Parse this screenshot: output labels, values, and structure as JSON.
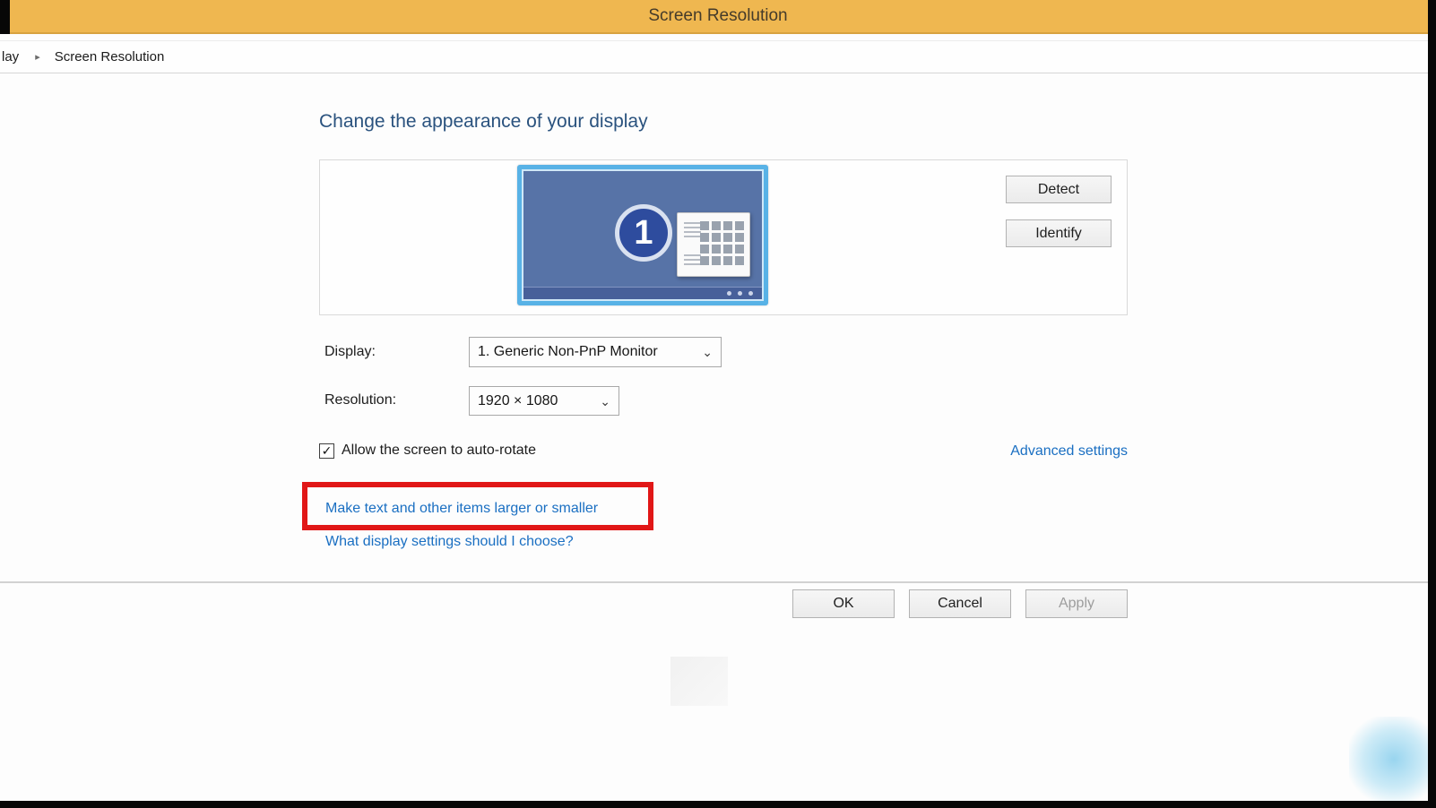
{
  "colors": {
    "titlebar_bg": "#efb750",
    "titlebar_text": "#453b2a",
    "heading_blue": "#2a527e",
    "link_blue": "#1a6fc2",
    "highlight_red": "#e11717",
    "monitor_frame": "#58b2e6",
    "monitor_screen": "#5773a7",
    "monitor_badge_bg": "#2e4c9e",
    "disabled_text": "#9d9d9d"
  },
  "window": {
    "title": "Screen Resolution"
  },
  "breadcrumb": {
    "parent_partial": "lay",
    "arrow": "▸",
    "current": "Screen Resolution"
  },
  "content": {
    "heading": "Change the appearance of your display",
    "monitor_badge": "1",
    "detect_button": "Detect",
    "identify_button": "Identify",
    "display_label": "Display:",
    "display_value": "1. Generic Non-PnP Monitor",
    "resolution_label": "Resolution:",
    "resolution_value": "1920 × 1080",
    "chevron": "⌄",
    "autorotate_label": "Allow the screen to auto-rotate",
    "autorotate_checked": true,
    "checkmark": "✓",
    "advanced_link": "Advanced settings",
    "make_text_link": "Make text and other items larger or smaller",
    "help_link": "What display settings should I choose?"
  },
  "footer": {
    "ok_button": "OK",
    "cancel_button": "Cancel",
    "apply_button": "Apply"
  }
}
